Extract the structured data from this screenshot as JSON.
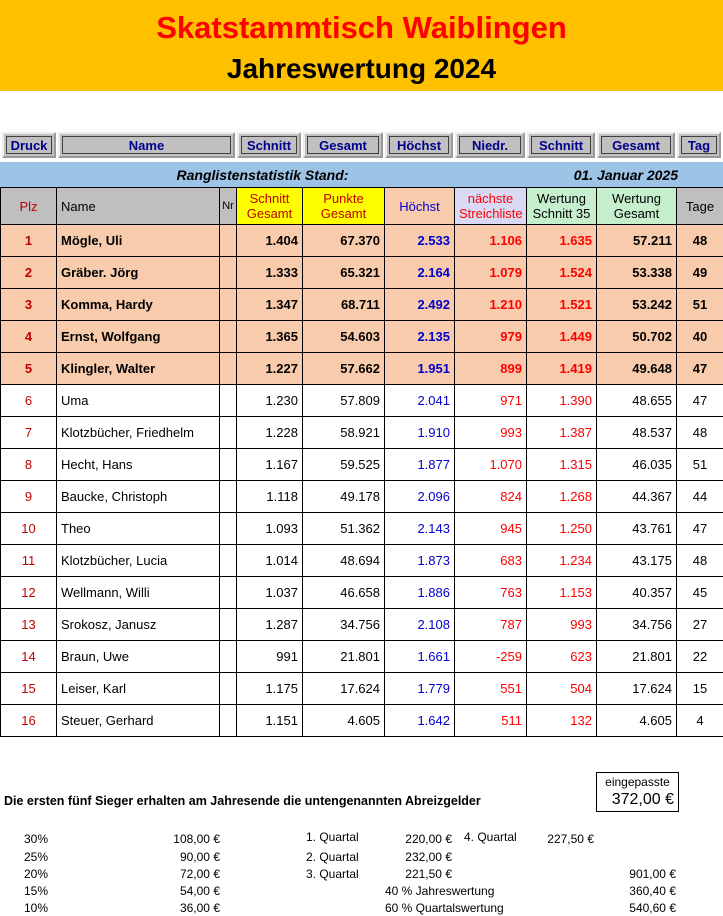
{
  "title": {
    "line1": "Skatstammtisch Waiblingen",
    "line2": "Jahreswertung 2024"
  },
  "buttons": [
    "Druck",
    "Name",
    "Schnitt",
    "Gesamt",
    "Höchst",
    "Niedr.",
    "Schnitt",
    "Gesamt",
    "Tag"
  ],
  "status": {
    "label": "Ranglistenstatistik Stand:",
    "date": "01. Januar 2025"
  },
  "headers": {
    "plz": "Plz",
    "name": "Name",
    "nr": "Nr",
    "schnitt": [
      "Schnitt",
      "Gesamt"
    ],
    "punkte": [
      "Punkte",
      "Gesamt"
    ],
    "hoechst": "Höchst",
    "streich": [
      "nächste",
      "Streichliste"
    ],
    "wschnitt": [
      "Wertung",
      "Schnitt 35"
    ],
    "wgesamt": [
      "Wertung",
      "Gesamt"
    ],
    "tage": "Tage"
  },
  "rows": [
    {
      "plz": "1",
      "name": "Mögle, Uli",
      "schnitt": "1.404",
      "punkte": "67.370",
      "hoechst": "2.533",
      "streich": "1.106",
      "wschnitt": "1.635",
      "wgesamt": "57.211",
      "tage": "48"
    },
    {
      "plz": "2",
      "name": "Gräber. Jörg",
      "schnitt": "1.333",
      "punkte": "65.321",
      "hoechst": "2.164",
      "streich": "1.079",
      "wschnitt": "1.524",
      "wgesamt": "53.338",
      "tage": "49"
    },
    {
      "plz": "3",
      "name": "Komma, Hardy",
      "schnitt": "1.347",
      "punkte": "68.711",
      "hoechst": "2.492",
      "streich": "1.210",
      "wschnitt": "1.521",
      "wgesamt": "53.242",
      "tage": "51"
    },
    {
      "plz": "4",
      "name": "Ernst, Wolfgang",
      "schnitt": "1.365",
      "punkte": "54.603",
      "hoechst": "2.135",
      "streich": "979",
      "wschnitt": "1.449",
      "wgesamt": "50.702",
      "tage": "40"
    },
    {
      "plz": "5",
      "name": "Klingler, Walter",
      "schnitt": "1.227",
      "punkte": "57.662",
      "hoechst": "1.951",
      "streich": "899",
      "wschnitt": "1.419",
      "wgesamt": "49.648",
      "tage": "47"
    },
    {
      "plz": "6",
      "name": "Uma",
      "schnitt": "1.230",
      "punkte": "57.809",
      "hoechst": "2.041",
      "streich": "971",
      "wschnitt": "1.390",
      "wgesamt": "48.655",
      "tage": "47"
    },
    {
      "plz": "7",
      "name": "Klotzbücher, Friedhelm",
      "schnitt": "1.228",
      "punkte": "58.921",
      "hoechst": "1.910",
      "streich": "993",
      "wschnitt": "1.387",
      "wgesamt": "48.537",
      "tage": "48"
    },
    {
      "plz": "8",
      "name": "Hecht, Hans",
      "schnitt": "1.167",
      "punkte": "59.525",
      "hoechst": "1.877",
      "streich": "1.070",
      "wschnitt": "1.315",
      "wgesamt": "46.035",
      "tage": "51"
    },
    {
      "plz": "9",
      "name": "Baucke, Christoph",
      "schnitt": "1.118",
      "punkte": "49.178",
      "hoechst": "2.096",
      "streich": "824",
      "wschnitt": "1.268",
      "wgesamt": "44.367",
      "tage": "44"
    },
    {
      "plz": "10",
      "name": "Theo",
      "schnitt": "1.093",
      "punkte": "51.362",
      "hoechst": "2.143",
      "streich": "945",
      "wschnitt": "1.250",
      "wgesamt": "43.761",
      "tage": "47"
    },
    {
      "plz": "11",
      "name": "Klotzbücher, Lucia",
      "schnitt": "1.014",
      "punkte": "48.694",
      "hoechst": "1.873",
      "streich": "683",
      "wschnitt": "1.234",
      "wgesamt": "43.175",
      "tage": "48"
    },
    {
      "plz": "12",
      "name": "Wellmann, Willi",
      "schnitt": "1.037",
      "punkte": "46.658",
      "hoechst": "1.886",
      "streich": "763",
      "wschnitt": "1.153",
      "wgesamt": "40.357",
      "tage": "45"
    },
    {
      "plz": "13",
      "name": "Srokosz, Janusz",
      "schnitt": "1.287",
      "punkte": "34.756",
      "hoechst": "2.108",
      "streich": "787",
      "wschnitt": "993",
      "wgesamt": "34.756",
      "tage": "27"
    },
    {
      "plz": "14",
      "name": "Braun, Uwe",
      "schnitt": "991",
      "punkte": "21.801",
      "hoechst": "1.661",
      "streich": "-259",
      "wschnitt": "623",
      "wgesamt": "21.801",
      "tage": "22"
    },
    {
      "plz": "15",
      "name": "Leiser, Karl",
      "schnitt": "1.175",
      "punkte": "17.624",
      "hoechst": "1.779",
      "streich": "551",
      "wschnitt": "504",
      "wgesamt": "17.624",
      "tage": "15"
    },
    {
      "plz": "16",
      "name": "Steuer, Gerhard",
      "schnitt": "1.151",
      "punkte": "4.605",
      "hoechst": "1.642",
      "streich": "511",
      "wschnitt": "132",
      "wgesamt": "4.605",
      "tage": "4"
    }
  ],
  "footer": {
    "eingepasste": "eingepasste",
    "amount": "372,00 €",
    "note": "Die ersten fünf Sieger erhalten am Jahresende die untengenannten Abreizgelder",
    "percents": [
      "30%",
      "25%",
      "20%",
      "15%",
      "10%"
    ],
    "payouts": [
      "108,00 €",
      "90,00 €",
      "72,00 €",
      "54,00 €",
      "36,00 €"
    ],
    "quartals": [
      {
        "label": "1. Quartal",
        "value": "220,00 €"
      },
      {
        "label": "2. Quartal",
        "value": "232,00 €"
      },
      {
        "label": "3. Quartal",
        "value": "221,50 €"
      }
    ],
    "q4_label": "4. Quartal",
    "q4_value": "227,50 €",
    "total": "901,00 €",
    "jahres_label": "40 % Jahreswertung",
    "jahres_value": "360,40 €",
    "quartals_label": "60 % Quartalswertung",
    "quartals_value": "540,60 €"
  }
}
